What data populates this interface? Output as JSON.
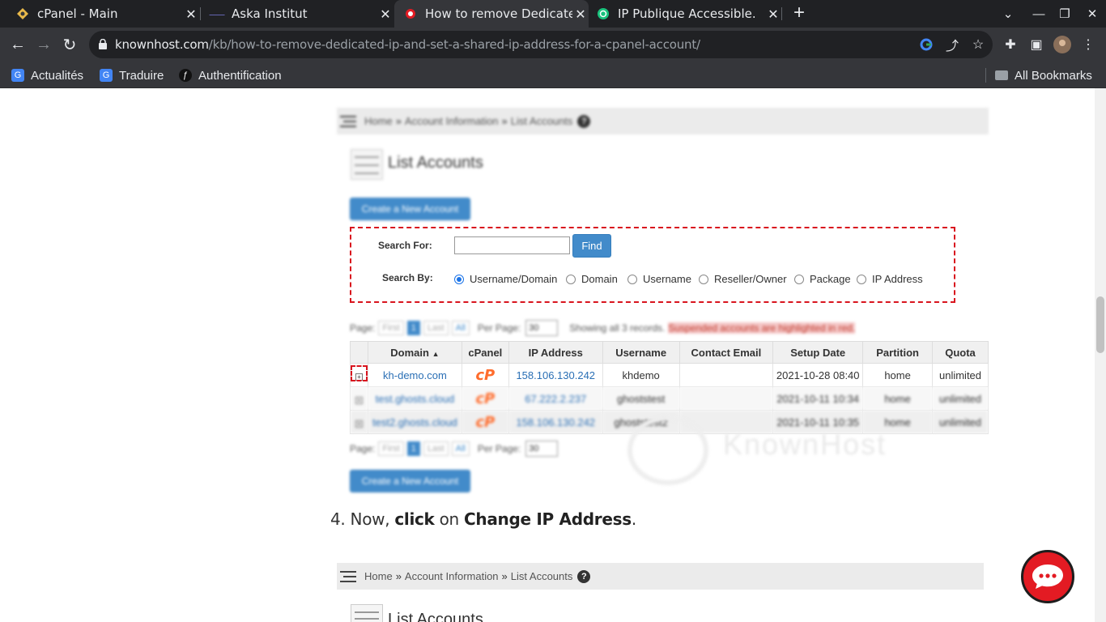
{
  "browser": {
    "tabs": [
      {
        "title": "cPanel - Main",
        "active": false
      },
      {
        "title": "Aska Institut",
        "active": false
      },
      {
        "title": "How to remove Dedicated",
        "active": true
      },
      {
        "title": "IP Publique Accessible.",
        "active": false
      }
    ],
    "url_host": "knownhost.com",
    "url_path": "/kb/how-to-remove-dedicated-ip-and-set-a-shared-ip-address-for-a-cpanel-account/",
    "bookmarks": [
      "Actualités",
      "Traduire",
      "Authentification"
    ],
    "all_bookmarks": "All Bookmarks"
  },
  "article": {
    "shot1": {
      "breadcrumb": [
        "Home",
        "Account Information",
        "List Accounts"
      ],
      "title": "List Accounts",
      "create_button": "Create a New Account",
      "search_for_label": "Search For:",
      "search_value": "",
      "find_button": "Find",
      "search_by_label": "Search By:",
      "search_options": [
        "Username/Domain",
        "Domain",
        "Username",
        "Reseller/Owner",
        "Package",
        "IP Address"
      ],
      "selected_option": "Username/Domain",
      "pager": {
        "page_label": "Page:",
        "first": "First",
        "current": "1",
        "last": "Last",
        "all": "All",
        "per_page_label": "Per Page:",
        "per_page": "30"
      },
      "showing_text": "Showing all 3 records.",
      "suspended_text": "Suspended accounts are highlighted in red.",
      "columns": [
        "Domain",
        "cPanel",
        "IP Address",
        "Username",
        "Contact Email",
        "Setup Date",
        "Partition",
        "Quota"
      ],
      "rows": [
        {
          "domain": "kh-demo.com",
          "cpanel": "cP",
          "ip": "158.106.130.242",
          "username": "khdemo",
          "email": "",
          "setup": "2021-10-28 08:40",
          "partition": "home",
          "quota": "unlimited"
        },
        {
          "domain": "test.ghosts.cloud",
          "cpanel": "cP",
          "ip": "67.222.2.237",
          "username": "ghoststest",
          "email": "",
          "setup": "2021-10-11 10:34",
          "partition": "home",
          "quota": "unlimited"
        },
        {
          "domain": "test2.ghosts.cloud",
          "cpanel": "cP",
          "ip": "158.106.130.242",
          "username": "ghoststest2",
          "email": "",
          "setup": "2021-10-11 10:35",
          "partition": "home",
          "quota": "unlimited"
        }
      ],
      "watermark": "KnownHost"
    },
    "step4": {
      "number": "4.",
      "pre": "Now,",
      "click": "click",
      "mid": "on",
      "target": "Change IP Address",
      "end": "."
    },
    "shot2": {
      "breadcrumb": [
        "Home",
        "Account Information",
        "List Accounts"
      ],
      "title": "List Accounts"
    }
  },
  "colors": {
    "accent": "#428bca",
    "highlight": "#d9141e",
    "chat": "#e31b23"
  }
}
